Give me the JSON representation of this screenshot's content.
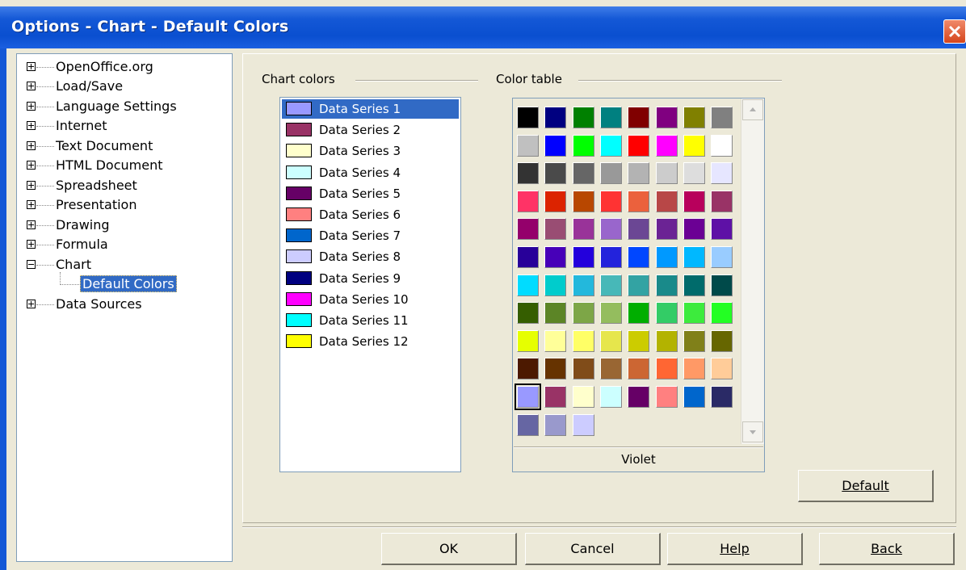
{
  "window": {
    "title": "Options - Chart - Default Colors"
  },
  "tree": {
    "items": [
      {
        "label": "OpenOffice.org",
        "expanded": false
      },
      {
        "label": "Load/Save",
        "expanded": false
      },
      {
        "label": "Language Settings",
        "expanded": false
      },
      {
        "label": "Internet",
        "expanded": false
      },
      {
        "label": "Text Document",
        "expanded": false
      },
      {
        "label": "HTML Document",
        "expanded": false
      },
      {
        "label": "Spreadsheet",
        "expanded": false
      },
      {
        "label": "Presentation",
        "expanded": false
      },
      {
        "label": "Drawing",
        "expanded": false
      },
      {
        "label": "Formula",
        "expanded": false
      },
      {
        "label": "Chart",
        "expanded": true
      },
      {
        "label": "Data Sources",
        "expanded": false
      }
    ],
    "selected_child": "Default Colors"
  },
  "chart_colors": {
    "label": "Chart colors",
    "selected_index": 0,
    "series": [
      {
        "name": "Data Series 1",
        "color": "#9999ff"
      },
      {
        "name": "Data Series 2",
        "color": "#993366"
      },
      {
        "name": "Data Series 3",
        "color": "#ffffcc"
      },
      {
        "name": "Data Series 4",
        "color": "#ccffff"
      },
      {
        "name": "Data Series 5",
        "color": "#660066"
      },
      {
        "name": "Data Series 6",
        "color": "#ff8080"
      },
      {
        "name": "Data Series 7",
        "color": "#0066cc"
      },
      {
        "name": "Data Series 8",
        "color": "#ccccff"
      },
      {
        "name": "Data Series 9",
        "color": "#000080"
      },
      {
        "name": "Data Series 10",
        "color": "#ff00ff"
      },
      {
        "name": "Data Series 11",
        "color": "#00ffff"
      },
      {
        "name": "Data Series 12",
        "color": "#ffff00"
      }
    ]
  },
  "color_table": {
    "label": "Color table",
    "selected_color_name": "Violet",
    "selected_index": 80,
    "colors": [
      "#000000",
      "#000080",
      "#008000",
      "#008080",
      "#800000",
      "#800080",
      "#808000",
      "#808080",
      "#c0c0c0",
      "#0000ff",
      "#00ff00",
      "#00ffff",
      "#ff0000",
      "#ff00ff",
      "#ffff00",
      "#ffffff",
      "#333333",
      "#4a4a4a",
      "#666666",
      "#999999",
      "#b3b3b3",
      "#cccccc",
      "#dddddd",
      "#e6e6ff",
      "#ff3366",
      "#dc2300",
      "#b84700",
      "#ff3333",
      "#eb613d",
      "#b84747",
      "#b8005c",
      "#993366",
      "#94006b",
      "#994d73",
      "#993399",
      "#9966cc",
      "#6b4794",
      "#6b2394",
      "#6b0094",
      "#5e11a6",
      "#280099",
      "#4700b8",
      "#2300dc",
      "#2323dc",
      "#0047ff",
      "#0099ff",
      "#00b8ff",
      "#99ccff",
      "#00dcff",
      "#00cccc",
      "#23b8dc",
      "#47b8b8",
      "#33a3a3",
      "#198a8a",
      "#006b6b",
      "#004a4a",
      "#355e00",
      "#5c8526",
      "#7da647",
      "#94bd5e",
      "#00ae00",
      "#33cc66",
      "#3deb3d",
      "#23ff23",
      "#e6ff00",
      "#ffff99",
      "#ffff66",
      "#e6e64c",
      "#cccc00",
      "#b3b300",
      "#808019",
      "#666600",
      "#4c1900",
      "#663300",
      "#804c19",
      "#996633",
      "#cc6633",
      "#ff6633",
      "#ff9966",
      "#ffcc99",
      "#9999ff",
      "#993366",
      "#ffffcc",
      "#ccffff",
      "#660066",
      "#ff8080",
      "#0066cc",
      "#2a2a66",
      "#6666a3",
      "#9999cc",
      "#ccccff"
    ]
  },
  "buttons": {
    "default": "Default",
    "ok": "OK",
    "cancel": "Cancel",
    "help": "Help",
    "back": "Back"
  }
}
